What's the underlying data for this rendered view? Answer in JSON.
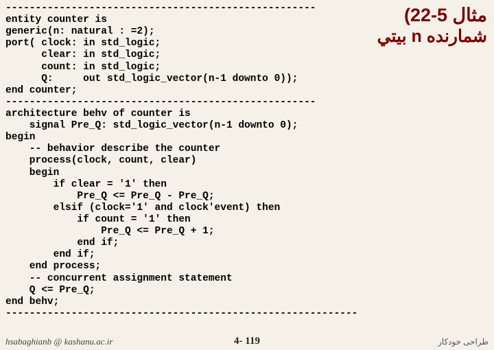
{
  "title": {
    "line1": "مثال 5-22)",
    "line2": "شمارنده n بيتي"
  },
  "code": "----------------------------------------------------\nentity counter is\ngeneric(n: natural : =2);\nport( clock: in std_logic;\n      clear: in std_logic;\n      count: in std_logic;\n      Q:     out std_logic_vector(n-1 downto 0));\nend counter;\n----------------------------------------------------\narchitecture behv of counter is\n    signal Pre_Q: std_logic_vector(n-1 downto 0);\nbegin\n    -- behavior describe the counter\n    process(clock, count, clear)\n    begin\n        if clear = '1' then\n            Pre_Q <= Pre_Q - Pre_Q;\n        elsif (clock='1' and clock'event) then\n            if count = '1' then\n                Pre_Q <= Pre_Q + 1;\n            end if;\n        end if;\n    end process;\n    -- concurrent assignment statement\n    Q <= Pre_Q;\nend behv;\n-----------------------------------------------------------",
  "footer": {
    "left": "hsabaghianb @ kashanu.ac.ir",
    "center": "4- 119",
    "right": "طراحی خودکار"
  }
}
